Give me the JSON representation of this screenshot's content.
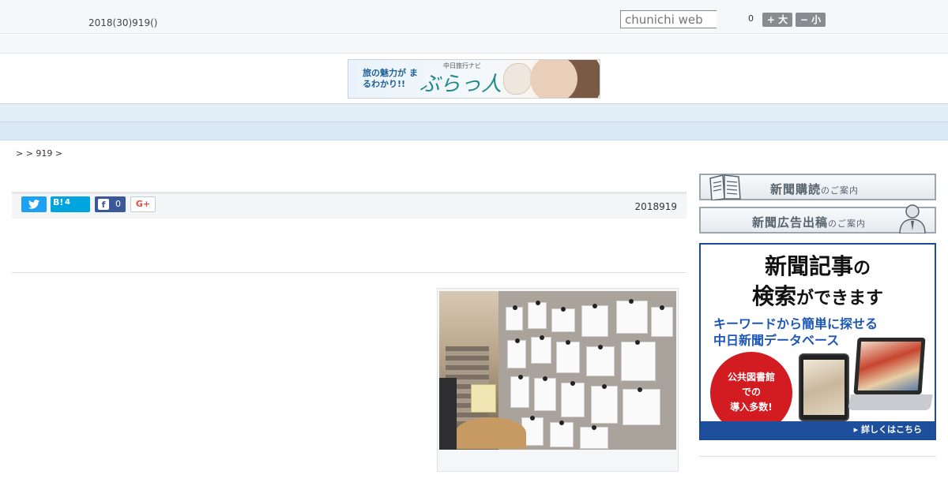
{
  "header": {
    "date_text": "2018(30)919()",
    "search_placeholder": "chunichi web",
    "font_size_count": "0",
    "font_larger_label": "+ 大",
    "font_smaller_label": "− 小"
  },
  "banner": {
    "tagline": "旅の魅力が まるわかり!!",
    "site_small": "中日旅行ナビ",
    "site_name": "ぶらっ人"
  },
  "nav": {
    "items": [
      "",
      "",
      "",
      "",
      "",
      "",
      "",
      "",
      ""
    ]
  },
  "breadcrumb": "> > 919 >",
  "share": {
    "hatena_label": "B!",
    "hatena_count": "4",
    "facebook_count": "0",
    "gplus_label": "G+"
  },
  "article": {
    "date": "2018919"
  },
  "sidebar": {
    "subscribe_main": "新聞購読",
    "subscribe_sub": "のご案内",
    "advert_main": "新聞広告出稿",
    "advert_sub": "のご案内",
    "db_ad": {
      "line1_a": "新聞記事",
      "line1_b": "の",
      "line2_a": "検索",
      "line2_b": "ができます",
      "sub_line1": "キーワードから簡単に探せる",
      "sub_line2": "中日新聞データベース",
      "circle_line1": "公共図書館",
      "circle_line2": "での",
      "circle_line3": "導入多数!",
      "footer": "▸ 詳しくはこちら"
    }
  },
  "colors": {
    "nav_bg": "#e4eef9",
    "twitter": "#1da1f2",
    "hatena": "#00a4de",
    "facebook": "#3b5998",
    "ad_blue": "#1d4f9c",
    "ad_red": "#d31b22"
  }
}
